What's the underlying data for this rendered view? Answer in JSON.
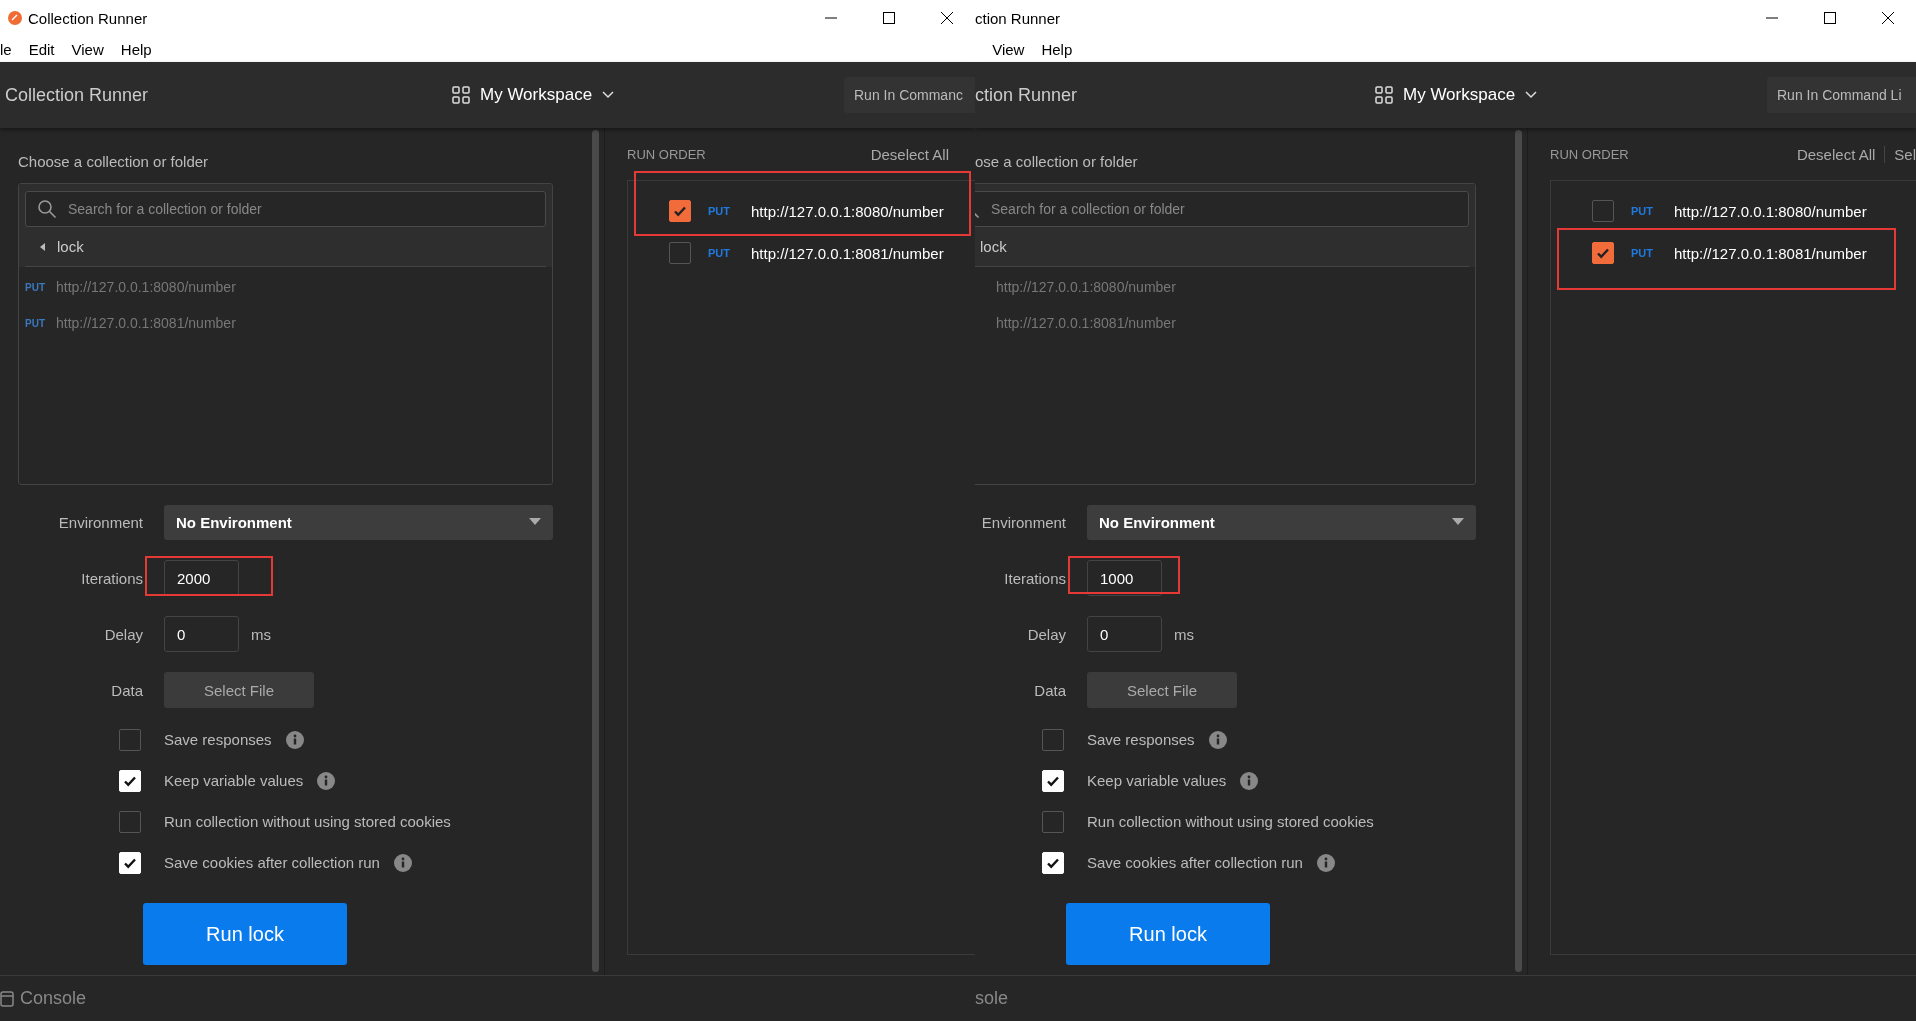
{
  "windows": [
    {
      "title": "Collection Runner",
      "app_icon": true,
      "menu": [
        "le",
        "Edit",
        "View",
        "Help"
      ],
      "header": {
        "title": "Collection Runner",
        "workspace": "My Workspace",
        "cli_button": "Run In Commanc"
      },
      "collection_picker": {
        "heading": "Choose a collection or folder",
        "search": {
          "placeholder": "Search for a collection or folder"
        },
        "folder": {
          "name": "lock",
          "caret": true
        },
        "requests": [
          {
            "method": "PUT",
            "url": "http://127.0.0.1:8080/number"
          },
          {
            "method": "PUT",
            "url": "http://127.0.0.1:8081/number"
          }
        ]
      },
      "settings": {
        "environment": {
          "label": "Environment",
          "value": "No Environment"
        },
        "iterations": {
          "label": "Iterations",
          "value": "2000",
          "highlighted": true
        },
        "delay": {
          "label": "Delay",
          "value": "0",
          "unit": "ms"
        },
        "data": {
          "label": "Data",
          "button": "Select File"
        },
        "options": [
          {
            "label": "Save responses",
            "checked": false,
            "info": true
          },
          {
            "label": "Keep variable values",
            "checked": true,
            "info": true
          },
          {
            "label": "Run collection without using stored cookies",
            "checked": false,
            "info": false
          },
          {
            "label": "Save cookies after collection run",
            "checked": true,
            "info": true
          }
        ],
        "run_button": "Run lock"
      },
      "run_order": {
        "heading": "RUN ORDER",
        "actions": [
          "Deselect All"
        ],
        "items": [
          {
            "method": "PUT",
            "url": "http://127.0.0.1:8080/number",
            "checked": true,
            "highlighted": true
          },
          {
            "method": "PUT",
            "url": "http://127.0.0.1:8081/number",
            "checked": false,
            "highlighted": false
          }
        ]
      },
      "console": {
        "label": "Console",
        "icon": true
      }
    },
    {
      "title": "ction Runner",
      "app_icon": false,
      "menu": [
        "View",
        "Help"
      ],
      "header": {
        "title": "ction Runner",
        "workspace": "My Workspace",
        "cli_button": "Run In Command Li"
      },
      "collection_picker": {
        "heading": "ose a collection or folder",
        "search": {
          "placeholder": "Search for a collection or folder"
        },
        "folder": {
          "name": "lock",
          "caret": false
        },
        "requests": [
          {
            "url": "http://127.0.0.1:8080/number"
          },
          {
            "url": "http://127.0.0.1:8081/number"
          }
        ]
      },
      "settings": {
        "environment": {
          "label": "Environment",
          "value": "No Environment"
        },
        "iterations": {
          "label": "Iterations",
          "value": "1000",
          "highlighted": true
        },
        "delay": {
          "label": "Delay",
          "value": "0",
          "unit": "ms"
        },
        "data": {
          "label": "Data",
          "button": "Select File"
        },
        "options": [
          {
            "label": "Save responses",
            "checked": false,
            "info": true
          },
          {
            "label": "Keep variable values",
            "checked": true,
            "info": true
          },
          {
            "label": "Run collection without using stored cookies",
            "checked": false,
            "info": false
          },
          {
            "label": "Save cookies after collection run",
            "checked": true,
            "info": true
          }
        ],
        "run_button": "Run lock"
      },
      "run_order": {
        "heading": "RUN ORDER",
        "actions": [
          "Deselect All",
          "Sel"
        ],
        "items": [
          {
            "method": "PUT",
            "url": "http://127.0.0.1:8080/number",
            "checked": false,
            "highlighted": false
          },
          {
            "method": "PUT",
            "url": "http://127.0.0.1:8081/number",
            "checked": true,
            "highlighted": true
          }
        ]
      },
      "console": {
        "label": "sole",
        "icon": false
      }
    }
  ]
}
